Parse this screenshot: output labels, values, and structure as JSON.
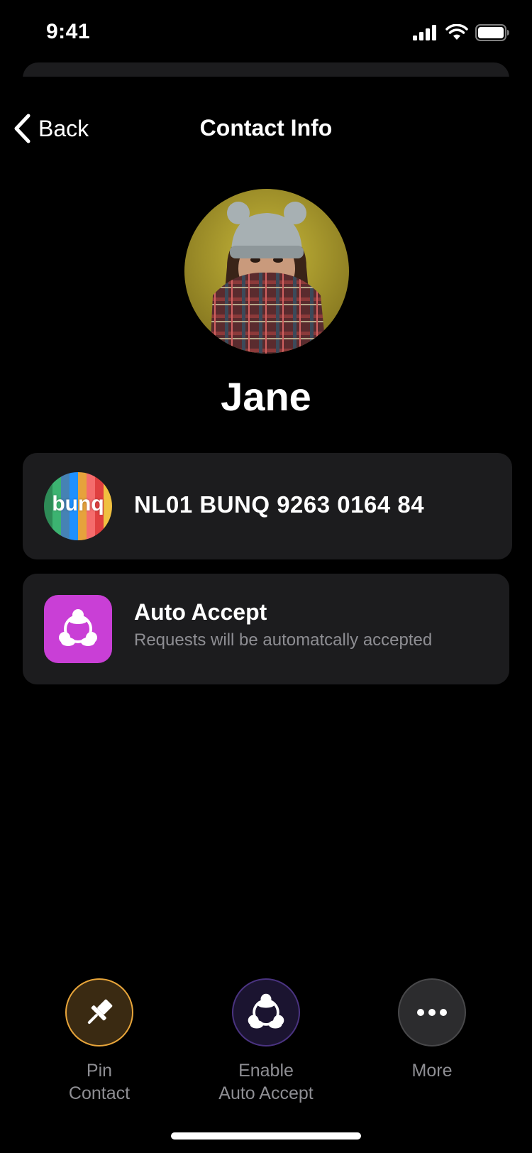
{
  "status_bar": {
    "time": "9:41"
  },
  "nav": {
    "back_label": "Back",
    "title": "Contact Info"
  },
  "contact": {
    "name": "Jane"
  },
  "iban_card": {
    "logo_text": "bunq",
    "iban": "NL01 BUNQ 9263 0164 84"
  },
  "auto_accept_card": {
    "title": "Auto Accept",
    "subtitle": "Requests will be automatcally accepted"
  },
  "actions": [
    {
      "line1": "Pin",
      "line2": "Contact",
      "icon": "pin-icon"
    },
    {
      "line1": "Enable",
      "line2": "Auto Accept",
      "icon": "auto-accept-icon"
    },
    {
      "line1": "More",
      "line2": "",
      "icon": "more-icon"
    }
  ],
  "colors": {
    "background": "#000000",
    "card": "#1c1c1e",
    "auto_accept_accent": "#c93fd6",
    "pin_accent": "#e8a53a",
    "secondary_text": "#8e8e93"
  }
}
